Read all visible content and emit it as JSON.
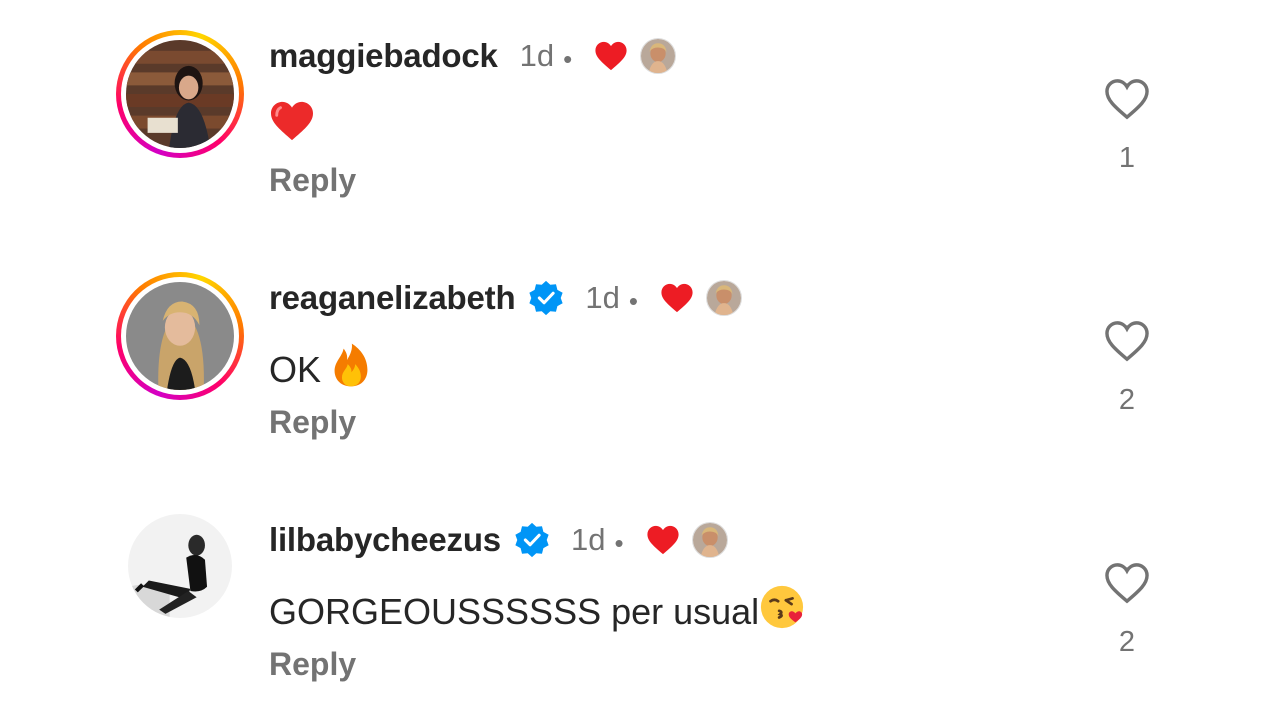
{
  "comments": [
    {
      "username": "maggiebadock",
      "verified": false,
      "time": "1d",
      "dot": "•",
      "text": "",
      "emoji": "❤️",
      "reply_label": "Reply",
      "likes": "1"
    },
    {
      "username": "reaganelizabeth",
      "verified": true,
      "time": "1d",
      "dot": "•",
      "text": "OK ",
      "emoji": "🔥",
      "reply_label": "Reply",
      "likes": "2"
    },
    {
      "username": "lilbabycheezus",
      "verified": true,
      "time": "1d",
      "dot": "•",
      "text": "GORGEOUSSSSSS per usual",
      "emoji": "😘",
      "reply_label": "Reply",
      "likes": "2"
    }
  ],
  "colors": {
    "text": "#262626",
    "secondary": "#737373",
    "heart_red": "#ed1c24",
    "verified_blue": "#0095f6"
  },
  "icons": {
    "like": "heart-outline-icon",
    "creator_like": "heart-filled-icon",
    "verified": "verified-badge-icon"
  }
}
